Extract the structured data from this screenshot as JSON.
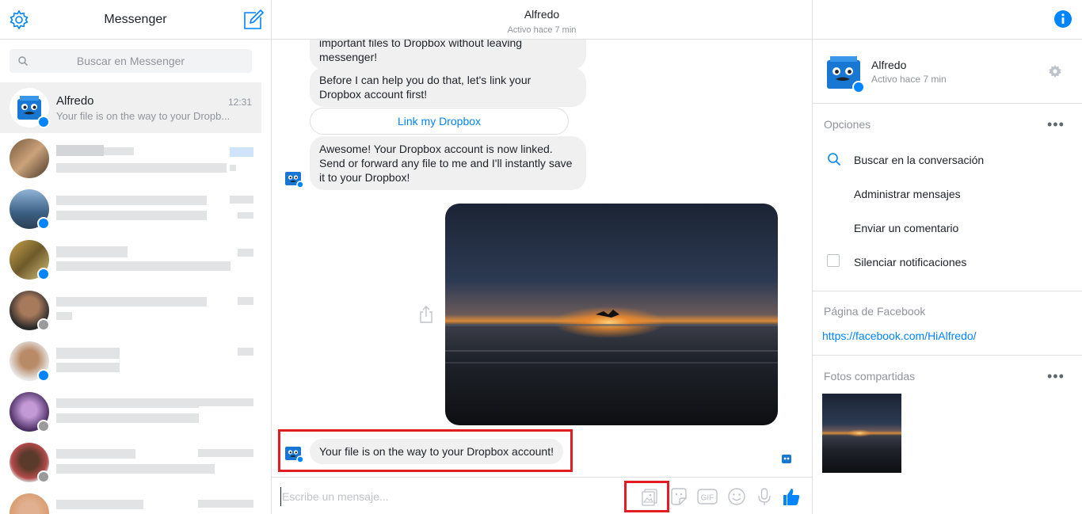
{
  "sidebar": {
    "title": "Messenger",
    "search_placeholder": "Buscar en Messenger",
    "conversations": [
      {
        "name": "Alfredo",
        "time": "12:31",
        "snippet": "Your file is on the way to your Dropb...",
        "badge": "messenger"
      }
    ]
  },
  "chat": {
    "title": "Alfredo",
    "status": "Activo hace 7 min",
    "messages": {
      "m1_line1": "important files to Dropbox without leaving",
      "m1_line2": "messenger!",
      "m2_line1": "Before I can help you do that, let's link your",
      "m2_line2": "Dropbox account first!",
      "link_button": "Link my Dropbox",
      "m3_line1": "Awesome! Your Dropbox account is now linked.",
      "m3_line2": "Send or forward any file to me and I'll instantly save",
      "m3_line3": "it to your Dropbox!",
      "m4": "Your file is on the way to your Dropbox account!"
    },
    "composer_placeholder": "Escribe un mensaje...",
    "composer_icons": [
      "photo-icon",
      "sticker-icon",
      "gif-icon",
      "emoji-icon",
      "microphone-icon",
      "thumbs-up-icon"
    ]
  },
  "info_panel": {
    "name": "Alfredo",
    "status": "Activo hace 7 min",
    "options_title": "Opciones",
    "options": [
      "Buscar en la conversación",
      "Administrar mensajes",
      "Enviar un comentario",
      "Silenciar notificaciones"
    ],
    "facebook_page_title": "Página de Facebook",
    "facebook_page_url": "https://facebook.com/HiAlfredo/",
    "shared_photos_title": "Fotos compartidas",
    "more_label": "•••"
  },
  "colors": {
    "accent": "#0084ff",
    "highlight": "#e31b23",
    "bubble": "#f1f0f0",
    "divider": "#dddfe2",
    "muted_text": "#90949c"
  }
}
